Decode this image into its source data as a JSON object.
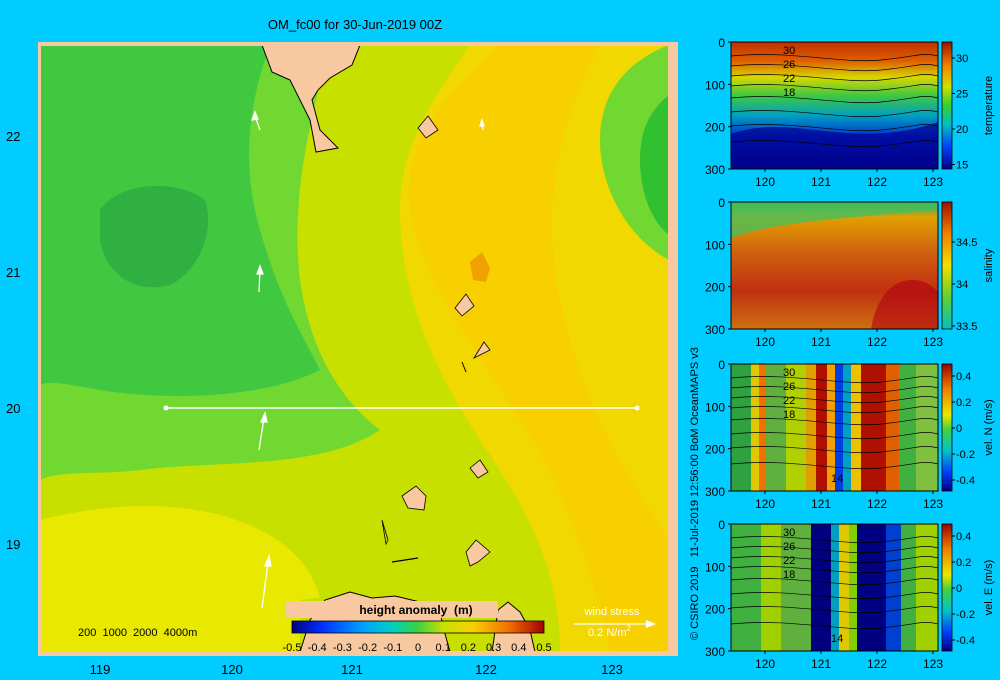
{
  "title": "OM_fc00 for 30-Jun-2019 00Z",
  "credit": "© CSIRO 2019   11-Jul-2019 12:56:00 BoM OceanMAPS v3",
  "colors": {
    "page_bg": "#00ccff",
    "land": "#f8c8a0",
    "frame": "#f8c8a0"
  },
  "main_map": {
    "x_ticks": [
      "119",
      "120",
      "121",
      "122",
      "123"
    ],
    "y_ticks": [
      "22",
      "21",
      "20",
      "19"
    ],
    "depth_legend": "200  1000  2000  4000m",
    "wind_label": "wind stress",
    "wind_unit": "0.2 N/m",
    "wind_unit_sup": "2",
    "colorbar": {
      "label": "height anomaly  (m)",
      "ticks": [
        "-0.5",
        "-0.4",
        "-0.3",
        "-0.2",
        "-0.1",
        "0",
        "0.1",
        "0.2",
        "0.3",
        "0.4",
        "0.5"
      ]
    }
  },
  "panels": [
    {
      "id": "temperature",
      "cbar_label": "temperature",
      "cbar_ticks": [
        "30",
        "25",
        "20",
        "15"
      ],
      "contour_labels": [
        "30",
        "26",
        "22",
        "18"
      ],
      "y_ticks": [
        "0",
        "100",
        "200",
        "300"
      ],
      "x_ticks": [
        "120",
        "121",
        "122",
        "123"
      ]
    },
    {
      "id": "salinity",
      "cbar_label": "salinity",
      "cbar_ticks": [
        "34.5",
        "34",
        "33.5"
      ],
      "contour_labels": [],
      "y_ticks": [
        "0",
        "100",
        "200",
        "300"
      ],
      "x_ticks": [
        "120",
        "121",
        "122",
        "123"
      ]
    },
    {
      "id": "vel-n",
      "cbar_label": "vel. N  (m/s)",
      "cbar_ticks": [
        "0.4",
        "0.2",
        "0",
        "-0.2",
        "-0.4"
      ],
      "contour_labels": [
        "30",
        "26",
        "22",
        "18",
        "14"
      ],
      "y_ticks": [
        "0",
        "100",
        "200",
        "300"
      ],
      "x_ticks": [
        "120",
        "121",
        "122",
        "123"
      ]
    },
    {
      "id": "vel-e",
      "cbar_label": "vel. E  (m/s)",
      "cbar_ticks": [
        "0.4",
        "0.2",
        "0",
        "-0.2",
        "-0.4"
      ],
      "contour_labels": [
        "30",
        "26",
        "22",
        "18",
        "14"
      ],
      "y_ticks": [
        "0",
        "100",
        "200",
        "300"
      ],
      "x_ticks": [
        "120",
        "121",
        "122",
        "123"
      ]
    }
  ],
  "chart_data": [
    {
      "type": "heatmap",
      "title": "OM_fc00 for 30-Jun-2019 00Z",
      "field": "height anomaly (m)",
      "x_range": [
        118.5,
        123.5
      ],
      "y_range": [
        18.3,
        22.7
      ],
      "colorbar_range": [
        -0.5,
        0.5
      ],
      "transect": {
        "lat": 20.0,
        "lon_start": 119.5,
        "lon_end": 123.2
      },
      "wind_vectors": [
        {
          "lon": 120.2,
          "lat": 22.1,
          "dir": "north"
        },
        {
          "lon": 120.25,
          "lat": 21.0,
          "dir": "north"
        },
        {
          "lon": 120.25,
          "lat": 19.95,
          "dir": "north"
        },
        {
          "lon": 120.3,
          "lat": 18.9,
          "dir": "north"
        },
        {
          "lon": 121.95,
          "lat": 22.1,
          "dir": "north"
        }
      ]
    },
    {
      "type": "heatmap",
      "field": "temperature",
      "x_range": [
        119.5,
        123.2
      ],
      "y_range": [
        300,
        0
      ],
      "colorbar_range": [
        15,
        31
      ]
    },
    {
      "type": "heatmap",
      "field": "salinity",
      "x_range": [
        119.5,
        123.2
      ],
      "y_range": [
        300,
        0
      ],
      "colorbar_range": [
        33.5,
        34.85
      ]
    },
    {
      "type": "heatmap",
      "field": "vel. N (m/s)",
      "x_range": [
        119.5,
        123.2
      ],
      "y_range": [
        300,
        0
      ],
      "colorbar_range": [
        -0.45,
        0.45
      ]
    },
    {
      "type": "heatmap",
      "field": "vel. E (m/s)",
      "x_range": [
        119.5,
        123.2
      ],
      "y_range": [
        300,
        0
      ],
      "colorbar_range": [
        -0.45,
        0.45
      ]
    }
  ]
}
